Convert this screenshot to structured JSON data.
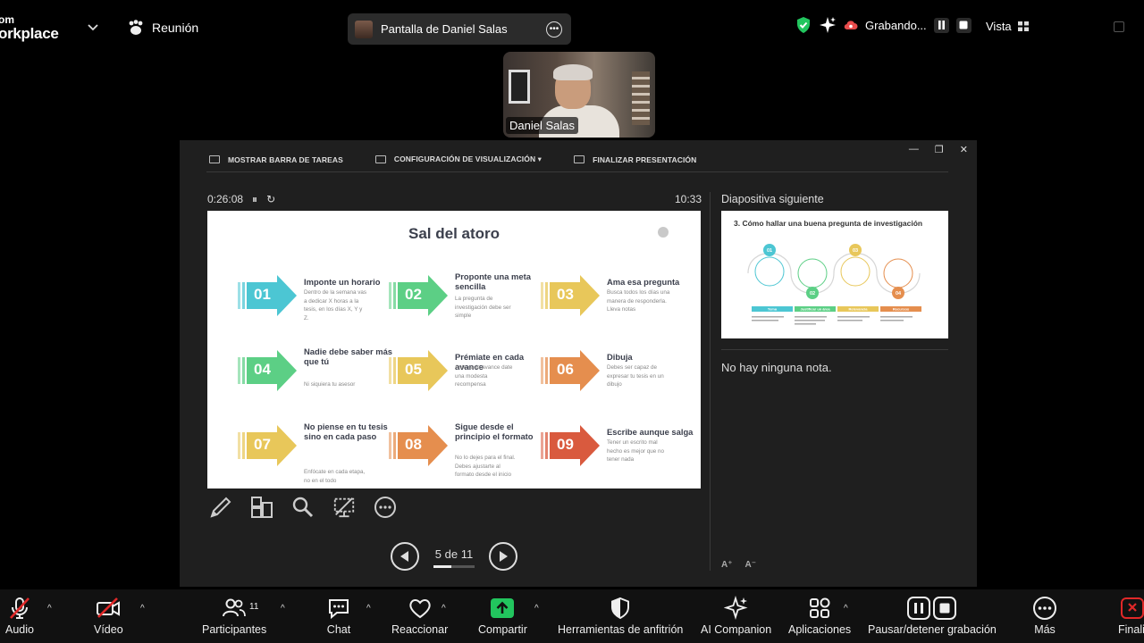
{
  "app": {
    "logo_line1": "om",
    "logo_line2": "orkplace",
    "meeting_label": "Reunión",
    "share_label": "Pantalla de Daniel Salas",
    "recording_label": "Grabando...",
    "view_label": "Vista"
  },
  "video": {
    "participant_name": "Daniel Salas"
  },
  "presenter": {
    "toolbar": {
      "show_taskbar": "MOSTRAR BARRA DE TAREAS",
      "display_settings": "CONFIGURACIÓN DE VISUALIZACIÓN ▾",
      "end_show": "FINALIZAR PRESENTACIÓN"
    },
    "elapsed": "0:26:08",
    "clock": "10:33",
    "next_slide_label": "Diapositiva siguiente",
    "notes_text": "No hay ninguna nota.",
    "page_indicator": "5 de 11"
  },
  "slide": {
    "title": "Sal del atoro",
    "steps": [
      {
        "num": "01",
        "color": "#4cc6d3",
        "head": "Imponte un horario",
        "desc": "Dentro de la semana vas a dedicar X horas a la tesis, en los días X, Y y Z."
      },
      {
        "num": "02",
        "color": "#5ccf85",
        "head": "Proponte una meta sencilla",
        "desc": "La pregunta de investigación debe ser simple"
      },
      {
        "num": "03",
        "color": "#e8c75a",
        "head": "Ama esa pregunta",
        "desc": "Busca todos los días una manera de responderla. Lleva notas"
      },
      {
        "num": "04",
        "color": "#5ccf85",
        "head": "Nadie debe saber más que tú",
        "desc": "Ni siquiera tu asesor"
      },
      {
        "num": "05",
        "color": "#e8c75a",
        "head": "Prémiate en cada avance",
        "desc": "Ante cada avance date una modesta recompensa"
      },
      {
        "num": "06",
        "color": "#e58e4e",
        "head": "Dibuja",
        "desc": "Debes ser capaz de expresar tu tesis en un dibujo"
      },
      {
        "num": "07",
        "color": "#e8c75a",
        "head": "No piense en tu tesis sino en cada paso",
        "desc": "Enfócate en cada etapa, no en el todo"
      },
      {
        "num": "08",
        "color": "#e58e4e",
        "head": "Sigue desde el principio el formato",
        "desc": "No lo dejes para el final. Debes ajustarte al formato desde el inicio"
      },
      {
        "num": "09",
        "color": "#d95a3e",
        "head": "Escribe aunque salga",
        "desc": "Tener un escrito mal hecho es mejor que no tener nada"
      }
    ]
  },
  "next_slide": {
    "title": "3. Cómo hallar una buena pregunta de investigación",
    "nums": [
      "01",
      "02",
      "03",
      "04"
    ],
    "labels": [
      "Tema",
      "Justificar un área",
      "Relevancia",
      "Recursos"
    ]
  },
  "toolbar": {
    "audio": "Audio",
    "video": "Vídeo",
    "participants": "Participantes",
    "participants_count": "11",
    "chat": "Chat",
    "reactions": "Reaccionar",
    "share": "Compartir",
    "host_tools": "Herramientas de anfitrión",
    "ai_companion": "AI Companion",
    "apps": "Aplicaciones",
    "pause_stop_rec": "Pausar/detener grabación",
    "more": "Más",
    "end": "Finali"
  },
  "colors": {
    "share_green": "#22c55e",
    "end_red": "#e02828",
    "shield_green": "#22c55e"
  }
}
